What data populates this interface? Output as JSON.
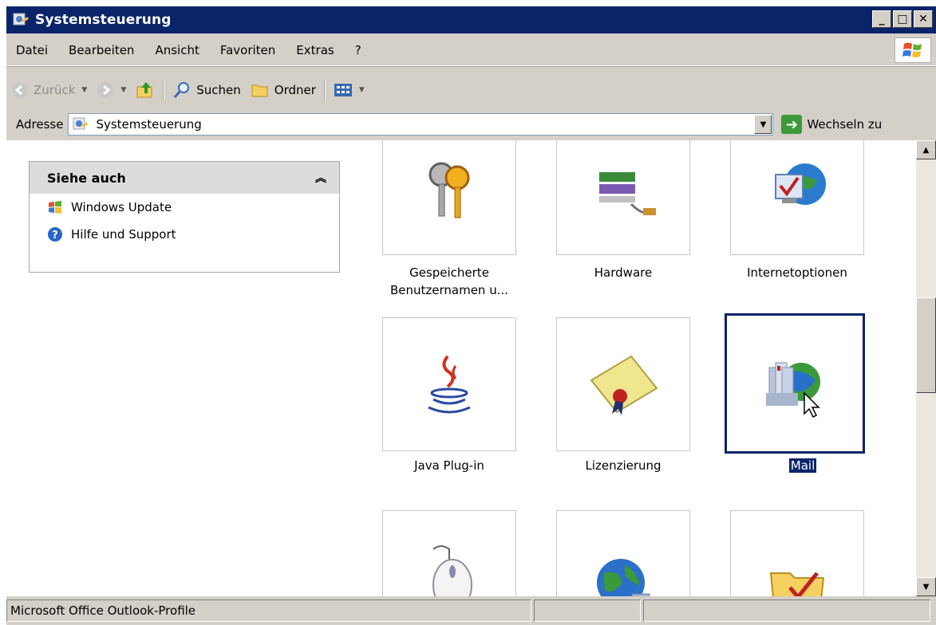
{
  "window": {
    "title": "Systemsteuerung",
    "controls": [
      "_",
      "□",
      "✕"
    ]
  },
  "menu": [
    "Datei",
    "Bearbeiten",
    "Ansicht",
    "Favoriten",
    "Extras",
    "?"
  ],
  "toolbar": {
    "back": "Zurück",
    "search": "Suchen",
    "folders": "Ordner"
  },
  "address": {
    "label": "Adresse",
    "value": "Systemsteuerung",
    "go": "Wechseln zu"
  },
  "see_also": {
    "title": "Siehe auch",
    "links": [
      "Windows Update",
      "Hilfe und Support"
    ]
  },
  "items": [
    {
      "name": "Gespeicherte",
      "name2": "Benutzernamen u...",
      "icon": "keys-icon"
    },
    {
      "name": "Hardware",
      "icon": "hardware-icon"
    },
    {
      "name": "Internetoptionen",
      "icon": "internet-options-icon"
    },
    {
      "name": "Java Plug-in",
      "icon": "java-icon"
    },
    {
      "name": "Lizenzierung",
      "icon": "license-icon"
    },
    {
      "name": "Mail",
      "icon": "mail-icon",
      "selected": true
    },
    {
      "name": "",
      "icon": "mouse-icon"
    },
    {
      "name": "",
      "icon": "network-icon"
    },
    {
      "name": "",
      "icon": "scheduled-folder-icon"
    }
  ],
  "status": {
    "text": "Microsoft Office Outlook-Profile"
  }
}
